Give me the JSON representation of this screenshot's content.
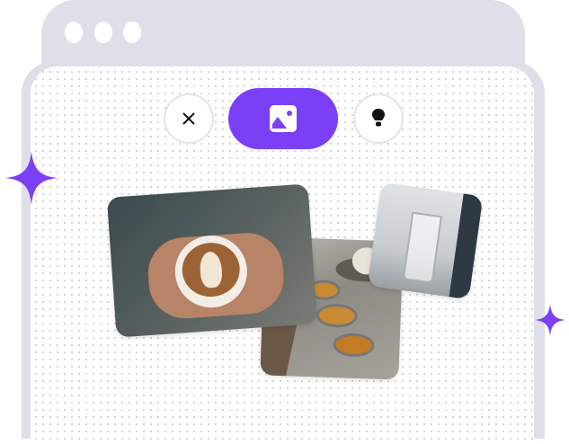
{
  "colors": {
    "accent": "#7b3ff6",
    "frame": "#dfdfea",
    "panel": "#ffffff",
    "button_border": "#e3e3ea",
    "icon": "#111111"
  },
  "window": {
    "controls": [
      "dot",
      "dot",
      "dot"
    ]
  },
  "toolbar": {
    "buttons": [
      {
        "icon": "close-icon",
        "active": false
      },
      {
        "icon": "image-icon",
        "active": true
      },
      {
        "icon": "lightbulb-icon",
        "active": false
      }
    ]
  },
  "photos": [
    {
      "subject": "latte-art-coffee"
    },
    {
      "subject": "tea-cups-on-table"
    },
    {
      "subject": "glass-of-water"
    }
  ],
  "decorations": [
    "sparkle-icon",
    "sparkle-icon"
  ]
}
